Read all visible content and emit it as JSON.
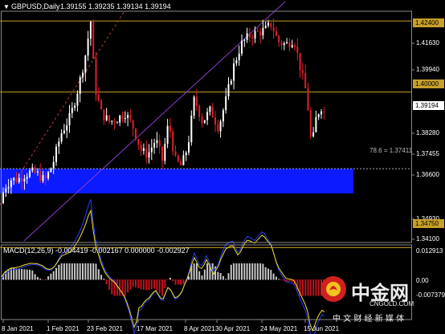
{
  "header": {
    "menu_arrow": "▼",
    "symbol": "GBPUSD,Daily",
    "ohlc": "1.39155 1.39235 1.39134 1.39194"
  },
  "macd": {
    "label": "MACD(12,26,9) -0.004419 -0.002167 0.000000 -0.002927"
  },
  "fib_label": "78.6 = 1.37411",
  "price_axis": {
    "ticks": [
      "1.41630",
      "1.39940",
      "1.38280",
      "1.37455",
      "1.36600",
      "1.34930",
      "1.34100"
    ],
    "level_tags": [
      "1.42400",
      "1.40000",
      "1.34750"
    ],
    "current_price": "1.39194"
  },
  "macd_axis": {
    "ticks": [
      "0.012913",
      "0.00",
      "-0.007379"
    ]
  },
  "time_axis": {
    "labels": [
      "8 Jan 2021",
      "1 Feb 2021",
      "23 Feb 2021",
      "17 Mar 2021",
      "8 Apr 2021",
      "30 Apr 2021",
      "24 May 2021",
      "15 Jun 2021"
    ]
  },
  "watermark": {
    "brand": "中金网",
    "domain": "CNGOLD.COM",
    "tagline": "中 文 财 经 新 媒 体"
  },
  "colors": {
    "background": "#000000",
    "bull_candle": "#ffffff",
    "bear_candle": "#e0202a",
    "horizontal_levels": "#c8a02a",
    "fib_zone": "#0b1aff",
    "channel": "#8a3cc8",
    "macd_signal": "#f0e020",
    "macd_main": "#2a3cff",
    "hist_pos": "#c8c8c8",
    "hist_neg": "#c0141e",
    "axis_text": "#ffffff"
  }
}
